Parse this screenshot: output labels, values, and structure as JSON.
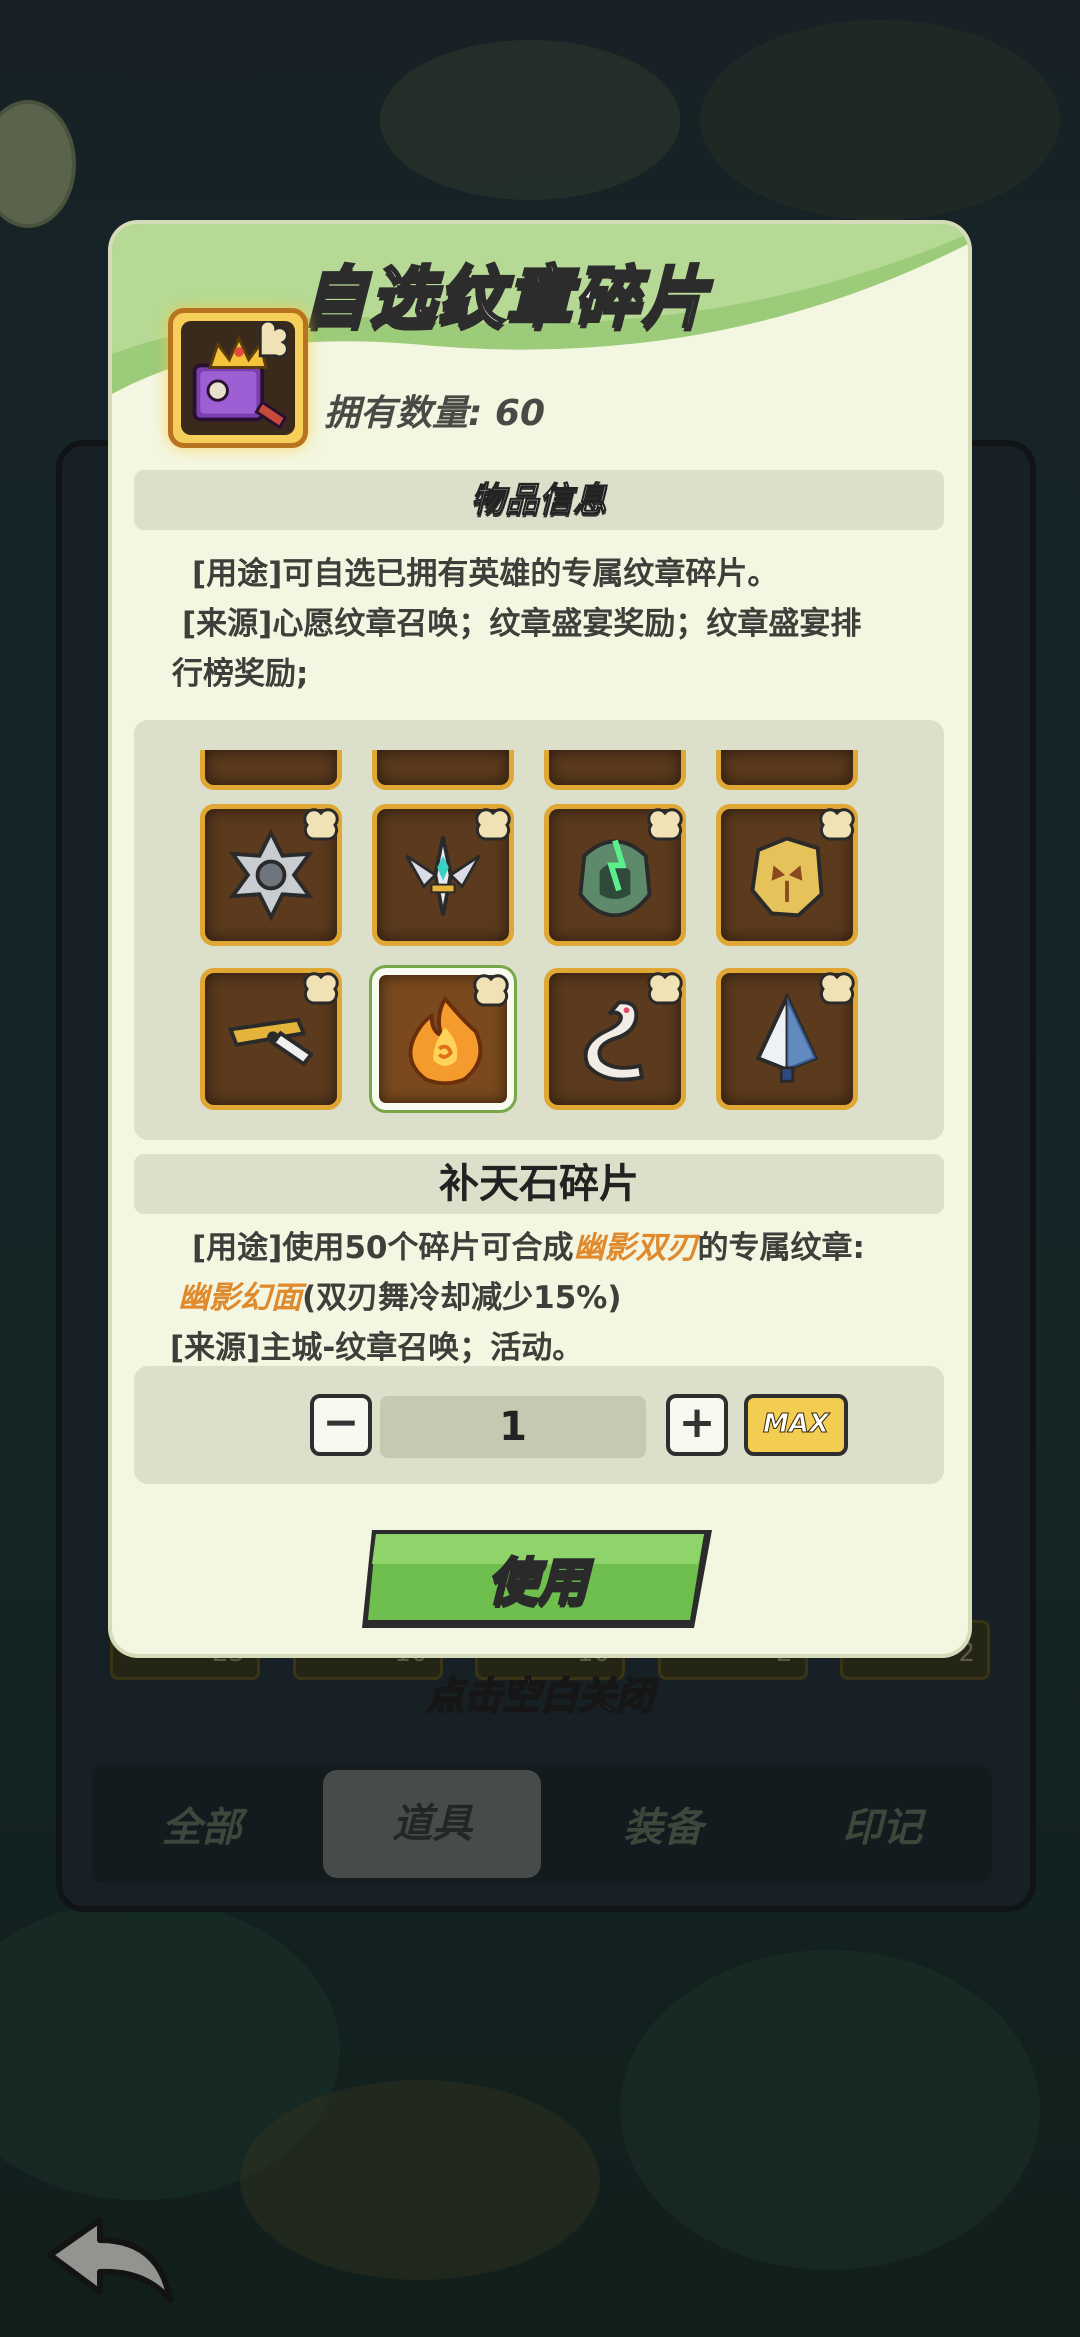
{
  "dialog": {
    "title": "自选纹章碎片",
    "owned_label": "拥有数量: 60",
    "info_header": "物品信息",
    "info_lines": [
      "[用途]可自选已拥有英雄的专属纹章碎片。",
      "[来源]心愿纹章召唤；纹章盛宴奖励；纹章盛宴排",
      "行榜奖励;"
    ],
    "shard_header": "补天石碎片",
    "shard_desc": {
      "line1_prefix": "[用途]使用50个碎片可合成",
      "line1_highlight": "幽影双刃",
      "line1_suffix": "的专属纹章:",
      "line2_highlight": "幽影幻面",
      "line2_suffix": "(双刃舞冷却减少15%)",
      "line3": "[来源]主城-纹章召唤；活动。"
    },
    "quantity": {
      "minus_label": "−",
      "value": "1",
      "plus_label": "+",
      "max_label": "MAX"
    },
    "use_button": "使用"
  },
  "grid_items": [
    {
      "name": "gear-emblem-icon"
    },
    {
      "name": "winged-crest-icon"
    },
    {
      "name": "green-horseshoe-icon"
    },
    {
      "name": "golden-mask-icon"
    },
    {
      "name": "golden-blade-icon"
    },
    {
      "name": "fire-stone-icon"
    },
    {
      "name": "white-serpent-icon"
    },
    {
      "name": "blue-feather-icon"
    }
  ],
  "background": {
    "tabs": [
      "全部",
      "道具",
      "装备",
      "印记"
    ],
    "active_tab": "道具",
    "close_hint": "点击空白关闭",
    "counts": [
      "25",
      "10",
      "10",
      "2",
      "2"
    ]
  },
  "colors": {
    "accent_green": "#6fbf4e",
    "highlight_orange": "#e08a2e",
    "slot_gold": "#e0a735"
  }
}
